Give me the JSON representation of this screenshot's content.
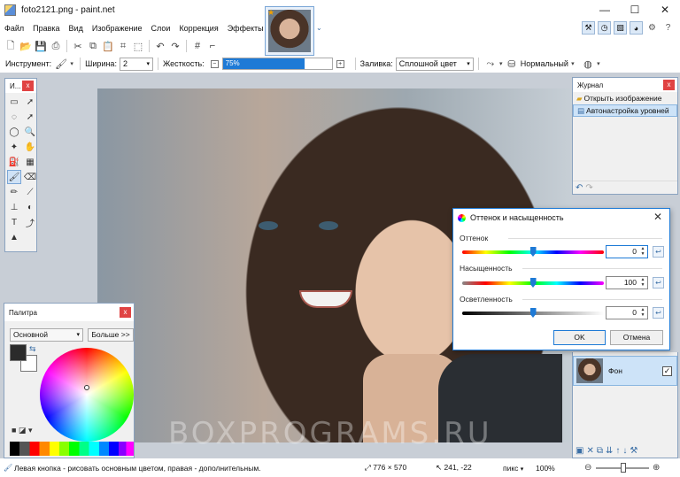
{
  "window": {
    "title": "foto2121.png - paint.net",
    "controls": [
      "—",
      "☐",
      "✕"
    ]
  },
  "menu": [
    "Файл",
    "Правка",
    "Вид",
    "Изображение",
    "Слои",
    "Коррекция",
    "Эффекты"
  ],
  "options": {
    "tool_label": "Инструмент:",
    "width_label": "Ширина:",
    "width_value": "2",
    "hardness_label": "Жесткость:",
    "hardness_value": "75%",
    "hardness_fraction": 0.75,
    "fill_label": "Заливка:",
    "fill_value": "Сплошной цвет",
    "blend_value": "Нормальный"
  },
  "tools_panel": {
    "title": "И...",
    "close": "x"
  },
  "journal": {
    "title": "Журнал",
    "close": "x",
    "items": [
      "Открыть изображение",
      "Автонастройка уровней"
    ],
    "selected_index": 1
  },
  "layers": {
    "items": [
      {
        "name": "Фон",
        "visible": "✓"
      }
    ]
  },
  "palette": {
    "title": "Палитра",
    "close": "x",
    "combo_value": "Основной",
    "more_label": "Больше >>"
  },
  "dialog": {
    "title": "Оттенок и насыщенность",
    "close": "✕",
    "hue_label": "Оттенок",
    "hue_value": "0",
    "saturation_label": "Насыщенность",
    "saturation_value": "100",
    "lightness_label": "Осветленность",
    "lightness_value": "0",
    "hue_fraction": 0.5,
    "saturation_fraction": 0.5,
    "lightness_fraction": 0.5,
    "ok_label": "OK",
    "cancel_label": "Отмена"
  },
  "watermark": "BOXPROGRAMS.RU",
  "status": {
    "hint": "Левая кнопка - рисовать основным цветом, правая - дополнительным.",
    "image_size": "776 × 570",
    "cursor_pos": "241, -22",
    "unit": "пикс",
    "zoom": "100%"
  },
  "colors": {
    "accent": "#1e7ad6",
    "close_red": "#e04343",
    "primary_color": "#2b2b2b"
  }
}
